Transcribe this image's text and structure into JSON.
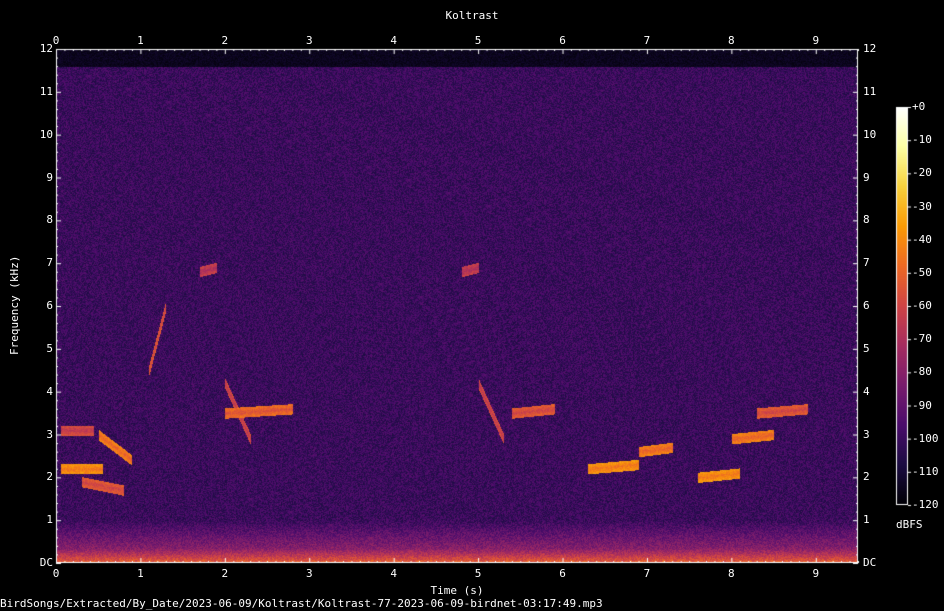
{
  "chart_data": {
    "type": "heatmap",
    "title": "Koltrast",
    "xlabel": "Time (s)",
    "ylabel": "Frequency (kHz)",
    "xlim": [
      0,
      9.5
    ],
    "ylim": [
      0,
      12
    ],
    "x_ticks": [
      "0",
      "1",
      "2",
      "3",
      "4",
      "5",
      "6",
      "7",
      "8",
      "9"
    ],
    "y_ticks": [
      "DC",
      "1",
      "2",
      "3",
      "4",
      "5",
      "6",
      "7",
      "8",
      "9",
      "10",
      "11",
      "12"
    ],
    "colorbar": {
      "label": "dBFS",
      "range": [
        -120,
        0
      ],
      "ticks": [
        "+0",
        "-10",
        "-20",
        "-30",
        "-40",
        "-50",
        "-60",
        "-70",
        "-80",
        "-90",
        "-100",
        "-110",
        "-120"
      ],
      "colormap": [
        "#000004",
        "#1b0c41",
        "#4a0c6b",
        "#781c6d",
        "#a52c60",
        "#cf4446",
        "#ed6925",
        "#fb9b06",
        "#f7d13d",
        "#fcffa4",
        "#ffffff"
      ]
    },
    "grid": true,
    "background": "#000000",
    "signal_features": [
      {
        "t0": 0.05,
        "t1": 0.55,
        "f0": 2.2,
        "f1": 2.2,
        "level": -45
      },
      {
        "t0": 0.05,
        "t1": 0.45,
        "f0": 3.1,
        "f1": 3.1,
        "level": -65
      },
      {
        "t0": 0.5,
        "t1": 0.9,
        "f0": 3.0,
        "f1": 2.4,
        "level": -50
      },
      {
        "t0": 0.3,
        "t1": 0.8,
        "f0": 1.9,
        "f1": 1.7,
        "level": -60
      },
      {
        "t0": 1.1,
        "t1": 1.3,
        "f0": 4.5,
        "f1": 6.0,
        "level": -60
      },
      {
        "t0": 2.0,
        "t1": 2.3,
        "f0": 4.2,
        "f1": 2.9,
        "level": -65
      },
      {
        "t0": 2.0,
        "t1": 2.8,
        "f0": 3.5,
        "f1": 3.6,
        "level": -55
      },
      {
        "t0": 5.0,
        "t1": 5.3,
        "f0": 4.2,
        "f1": 2.9,
        "level": -65
      },
      {
        "t0": 5.4,
        "t1": 5.9,
        "f0": 3.5,
        "f1": 3.6,
        "level": -60
      },
      {
        "t0": 6.3,
        "t1": 6.9,
        "f0": 2.2,
        "f1": 2.3,
        "level": -45
      },
      {
        "t0": 6.9,
        "t1": 7.3,
        "f0": 2.6,
        "f1": 2.7,
        "level": -50
      },
      {
        "t0": 7.6,
        "t1": 8.1,
        "f0": 2.0,
        "f1": 2.1,
        "level": -45
      },
      {
        "t0": 8.0,
        "t1": 8.5,
        "f0": 2.9,
        "f1": 3.0,
        "level": -50
      },
      {
        "t0": 8.3,
        "t1": 8.9,
        "f0": 3.5,
        "f1": 3.6,
        "level": -60
      },
      {
        "t0": 1.7,
        "t1": 1.9,
        "f0": 6.8,
        "f1": 6.9,
        "level": -70
      },
      {
        "t0": 4.8,
        "t1": 5.0,
        "f0": 6.8,
        "f1": 6.9,
        "level": -70
      }
    ]
  },
  "footer": {
    "filename": "BirdSongs/Extracted/By_Date/2023-06-09/Koltrast/Koltrast-77-2023-06-09-birdnet-03:17:49.mp3"
  }
}
